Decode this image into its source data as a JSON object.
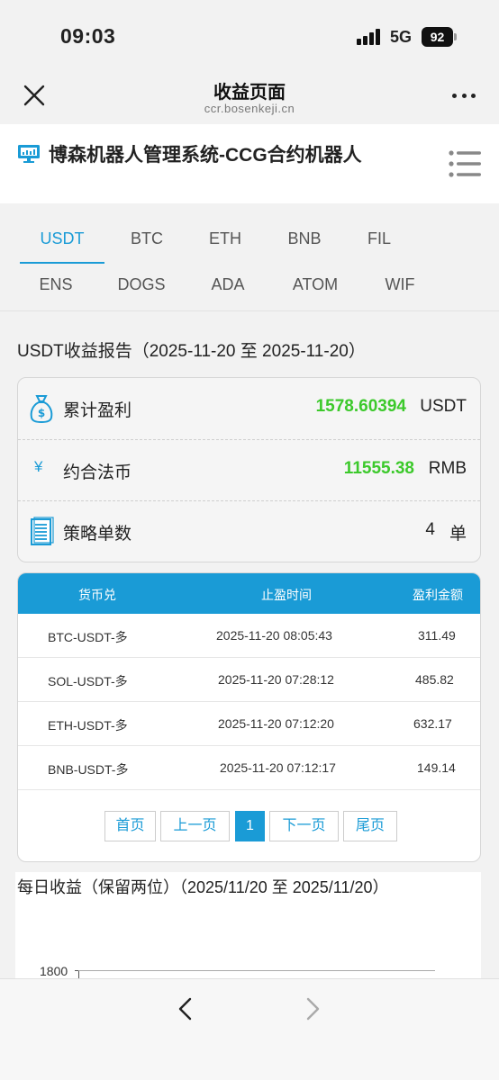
{
  "status_bar": {
    "time": "09:03",
    "network": "5G",
    "battery": "92"
  },
  "nav": {
    "title": "收益页面",
    "subtitle": "ccr.bosenkeji.cn"
  },
  "app": {
    "title": "博森机器人管理系统-CCG合约机器人"
  },
  "tabs": [
    {
      "label": "USDT",
      "active": true
    },
    {
      "label": "BTC"
    },
    {
      "label": "ETH"
    },
    {
      "label": "BNB"
    },
    {
      "label": "FIL"
    },
    {
      "label": "ENS"
    },
    {
      "label": "DOGS"
    },
    {
      "label": "ADA"
    },
    {
      "label": "ATOM"
    },
    {
      "label": "WIF"
    }
  ],
  "report": {
    "title": "USDT收益报告（2025-11-20 至 2025-11-20）",
    "rows": [
      {
        "label": "累计盈利",
        "value": "1578.60394",
        "unit": "USDT",
        "icon": "money-bag-icon"
      },
      {
        "label": "约合法币",
        "value": "11555.38",
        "unit": "RMB",
        "icon": "yen-icon",
        "icon_glyph": "¥"
      },
      {
        "label": "策略单数",
        "value": "4",
        "unit": "单",
        "icon": "document-icon"
      }
    ]
  },
  "table": {
    "headers": [
      "货币兑",
      "止盈时间",
      "盈利金额"
    ],
    "rows": [
      [
        "BTC-USDT-多",
        "2025-11-20 08:05:43",
        "311.49"
      ],
      [
        "SOL-USDT-多",
        "2025-11-20 07:28:12",
        "485.82"
      ],
      [
        "ETH-USDT-多",
        "2025-11-20 07:12:20",
        "632.17"
      ],
      [
        "BNB-USDT-多",
        "2025-11-20 07:12:17",
        "149.14"
      ]
    ]
  },
  "pagination": {
    "first": "首页",
    "prev": "上一页",
    "current": "1",
    "next": "下一页",
    "last": "尾页"
  },
  "daily": {
    "title": "每日收益（保留两位）（2025/11/20 至 2025/11/20）",
    "y_tick_top": "1800"
  },
  "colors": {
    "accent": "#1a9bd6",
    "profit_green": "#3cc92b"
  }
}
